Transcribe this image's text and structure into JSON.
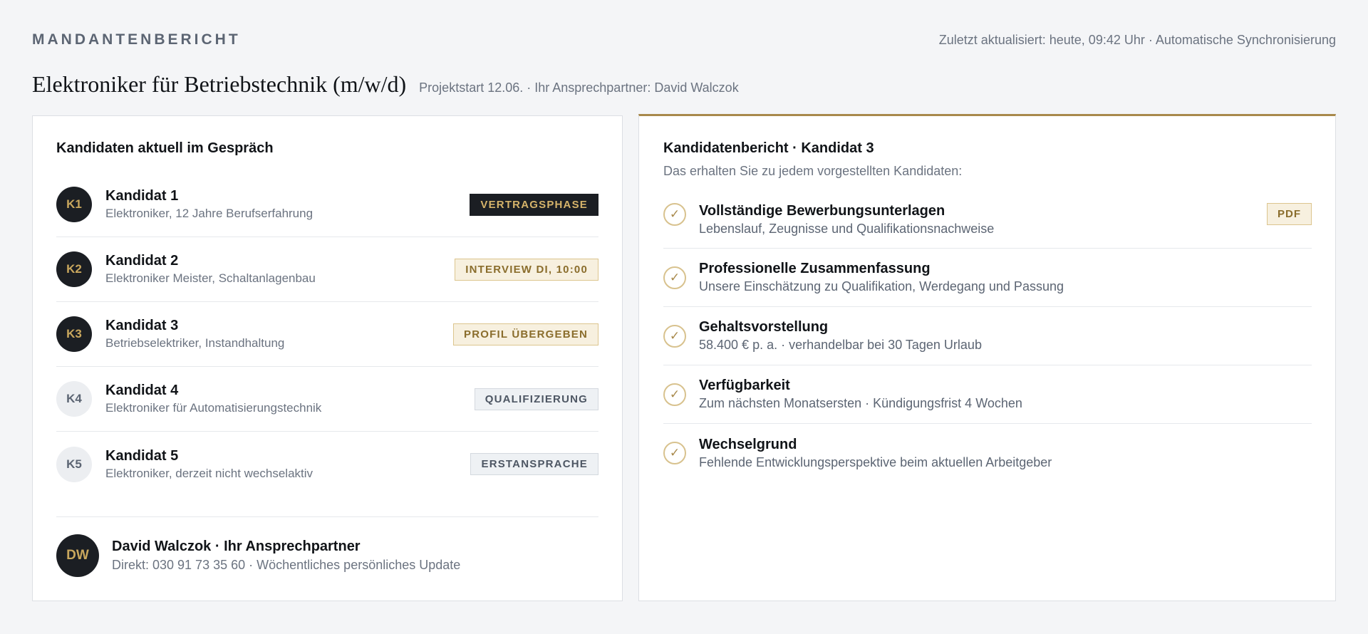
{
  "header": {
    "brand": "MANDANTENBERICHT",
    "updated": "Zuletzt aktualisiert: heute, 09:42 Uhr · Automatische Synchronisierung",
    "title": "Elektroniker für Betriebstechnik (m/w/d)",
    "subtitle": "Projektstart 12.06. · Ihr Ansprechpartner: David Walczok"
  },
  "candidates": {
    "heading": "Kandidaten aktuell im Gespräch",
    "items": [
      {
        "initials": "K1",
        "name": "Kandidat 1",
        "desc": "Elektroniker, 12 Jahre Berufserfahrung",
        "status": "VERTRAGSPHASE"
      },
      {
        "initials": "K2",
        "name": "Kandidat 2",
        "desc": "Elektroniker Meister, Schaltanlagenbau",
        "status": "INTERVIEW DI, 10:00"
      },
      {
        "initials": "K3",
        "name": "Kandidat 3",
        "desc": "Betriebselektriker, Instandhaltung",
        "status": "PROFIL ÜBERGEBEN"
      },
      {
        "initials": "K4",
        "name": "Kandidat 4",
        "desc": "Elektroniker für Automatisierungstechnik",
        "status": "QUALIFIZIERUNG"
      },
      {
        "initials": "K5",
        "name": "Kandidat 5",
        "desc": "Elektroniker, derzeit nicht wechselaktiv",
        "status": "ERSTANSPRACHE"
      }
    ]
  },
  "contact": {
    "initials": "DW",
    "name": "David Walczok · Ihr Ansprechpartner",
    "desc": "Direkt: 030 91 73 35 60 · Wöchentliches persönliches Update"
  },
  "report": {
    "heading": "Kandidatenbericht · Kandidat 3",
    "intro": "Das erhalten Sie zu jedem vorgestellten Kandidaten:",
    "check_glyph": "✓",
    "items": [
      {
        "title": "Vollständige Bewerbungsunterlagen",
        "desc": "Lebenslauf, Zeugnisse und Qualifikationsnachweise",
        "tag": "PDF"
      },
      {
        "title": "Professionelle Zusammenfassung",
        "desc": "Unsere Einschätzung zu Qualifikation, Werdegang und Passung"
      },
      {
        "title": "Gehaltsvorstellung",
        "desc": "58.400 € p. a. · verhandelbar bei 30 Tagen Urlaub"
      },
      {
        "title": "Verfügbarkeit",
        "desc": "Zum nächsten Monatsersten · Kündigungsfrist 4 Wochen"
      },
      {
        "title": "Wechselgrund",
        "desc": "Fehlende Entwicklungsperspektive beim aktuellen Arbeitgeber"
      }
    ]
  },
  "colors": {
    "accent_gold": "#a8894b",
    "dark": "#1b1e23",
    "muted_text": "#6b7380"
  }
}
